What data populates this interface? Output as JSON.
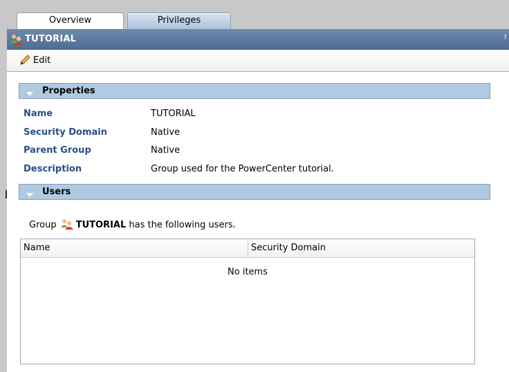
{
  "tabs": [
    {
      "label": "Overview",
      "active": true
    },
    {
      "label": "Privileges",
      "active": false
    }
  ],
  "titlebar": {
    "title": "TUTORIAL",
    "help": "?",
    "icon": "group-icon"
  },
  "toolbar": {
    "edit_label": "Edit",
    "icon": "pencil-icon"
  },
  "properties": {
    "header": "Properties",
    "rows": [
      {
        "label": "Name",
        "value": "TUTORIAL"
      },
      {
        "label": "Security Domain",
        "value": "Native"
      },
      {
        "label": "Parent Group",
        "value": "Native"
      },
      {
        "label": "Description",
        "value": "Group used for the PowerCenter tutorial."
      }
    ]
  },
  "users": {
    "header": "Users",
    "prefix": "Group",
    "group_name": "TUTORIAL",
    "suffix": "has the following users.",
    "columns": [
      "Name",
      "Security Domain"
    ],
    "empty_text": "No items"
  },
  "colors": {
    "titlebar": "#5a7699",
    "section_header": "#b1c9e1",
    "label_blue": "#2a4e86"
  }
}
